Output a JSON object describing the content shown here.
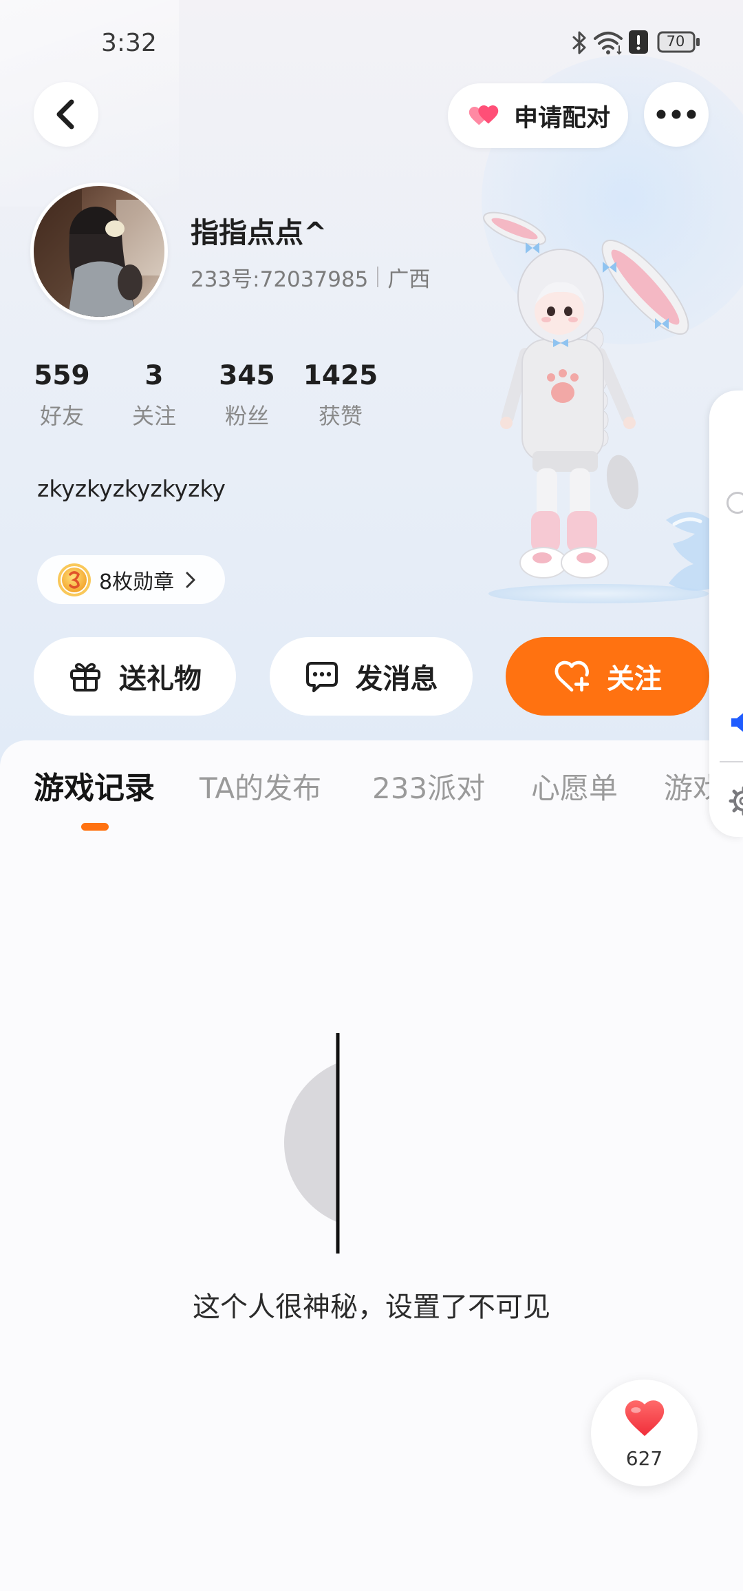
{
  "status_bar": {
    "time": "3:32",
    "battery_level": "70",
    "icons": [
      "bluetooth-icon",
      "wifi-icon",
      "alert-icon",
      "battery-icon"
    ]
  },
  "header": {
    "back_icon": "chevron-left-icon",
    "pair_button": {
      "label": "申请配对",
      "icon": "double-heart-icon"
    },
    "more_icon": "more-dots-icon"
  },
  "profile": {
    "name": "指指点点^",
    "id_text": "233号:72037985",
    "location": "广西",
    "bio": "zkyzkyzkyzkyzky"
  },
  "stats": [
    {
      "value": "559",
      "label": "好友"
    },
    {
      "value": "3",
      "label": "关注"
    },
    {
      "value": "345",
      "label": "粉丝"
    },
    {
      "value": "1425",
      "label": "获赞"
    }
  ],
  "badges": {
    "label": "8枚勋章",
    "icon": "medal-icon"
  },
  "actions": {
    "gift": {
      "label": "送礼物",
      "icon": "gift-icon"
    },
    "message": {
      "label": "发消息",
      "icon": "chat-bubble-icon"
    },
    "follow": {
      "label": "关注",
      "icon": "heart-plus-icon"
    }
  },
  "tabs": [
    {
      "label": "游戏记录",
      "active": true
    },
    {
      "label": "TA的发布",
      "active": false
    },
    {
      "label": "233派对",
      "active": false
    },
    {
      "label": "心愿单",
      "active": false
    },
    {
      "label": "游戏",
      "active": false
    }
  ],
  "empty_state": {
    "message": "这个人很神秘，设置了不可见"
  },
  "like_float": {
    "count": "627",
    "icon": "heart-icon"
  },
  "floating_toolbar": {
    "icons": [
      "circle-icon",
      "speaker-icon",
      "gear-icon"
    ]
  },
  "colors": {
    "accent": "#ff7211",
    "text_primary": "#1f1f1f",
    "text_secondary": "#8a8a8a",
    "pair_heart": "#ff5b7f",
    "like_heart": "#f43f3f",
    "card_background": "#fbfbfd"
  }
}
